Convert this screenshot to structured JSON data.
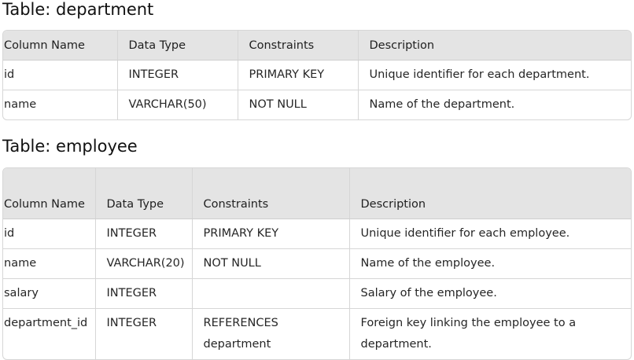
{
  "department_table": {
    "title": "Table: department",
    "headers": [
      "Column Name",
      "Data Type",
      "Constraints",
      "Description"
    ],
    "rows": [
      [
        "id",
        "INTEGER",
        "PRIMARY KEY",
        "Unique identifier for each department."
      ],
      [
        "name",
        "VARCHAR(50)",
        "NOT NULL",
        "Name of the department."
      ]
    ]
  },
  "employee_table": {
    "title": "Table: employee",
    "headers": [
      "Column Name",
      "Data Type",
      "Constraints",
      "Description"
    ],
    "rows": [
      [
        "id",
        "INTEGER",
        "PRIMARY KEY",
        "Unique identifier for each employee."
      ],
      [
        "name",
        "VARCHAR(20)",
        "NOT NULL",
        "Name of the employee."
      ],
      [
        "salary",
        "INTEGER",
        "",
        "Salary of the employee."
      ],
      [
        "department_id",
        "INTEGER",
        "REFERENCES department",
        "Foreign key linking the employee to a department."
      ]
    ]
  }
}
